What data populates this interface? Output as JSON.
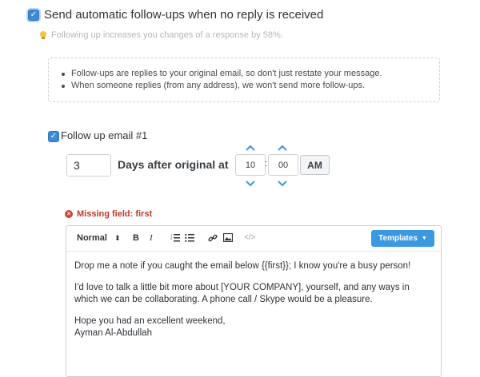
{
  "auto_followups": {
    "checked": true,
    "label": "Send automatic follow-ups when no reply is received",
    "tip": "Following up increases you changes of a response by 58%."
  },
  "info": {
    "items": [
      "Follow-ups are replies to your original email, so don't just restate your message.",
      "When someone replies (from any address), we won't send more follow-ups."
    ]
  },
  "followup1": {
    "checked": true,
    "label": "Follow up email #1",
    "days_value": "3",
    "days_label": "Days after original at",
    "hour": "10",
    "minute": "00",
    "time_separator": ":",
    "ampm": "AM",
    "missing_field": "Missing field: first"
  },
  "editor": {
    "format": "Normal",
    "bold": "B",
    "italic": "I",
    "code": "</>",
    "templates_label": "Templates",
    "body": [
      "Drop me a note if you caught the email below {{first}}; I know you're a busy person!",
      "I'd love to talk a little bit more about [YOUR COMPANY], yourself, and any ways in which we can be collaborating. A phone call / Skype would be a pleasure.",
      "Hope you had an excellent weekend,",
      "Ayman Al-Abdullah"
    ]
  },
  "colors": {
    "accent": "#3d8bd6",
    "templates_button": "#3b99e0",
    "error": "#c0392b",
    "chevron": "#3b99e0"
  },
  "icons": [
    "check-icon",
    "lightbulb-icon",
    "chevron-up-icon",
    "chevron-down-icon",
    "error-icon",
    "ordered-list-icon",
    "bullet-list-icon",
    "link-icon",
    "image-icon",
    "code-icon",
    "caret-down-icon"
  ]
}
